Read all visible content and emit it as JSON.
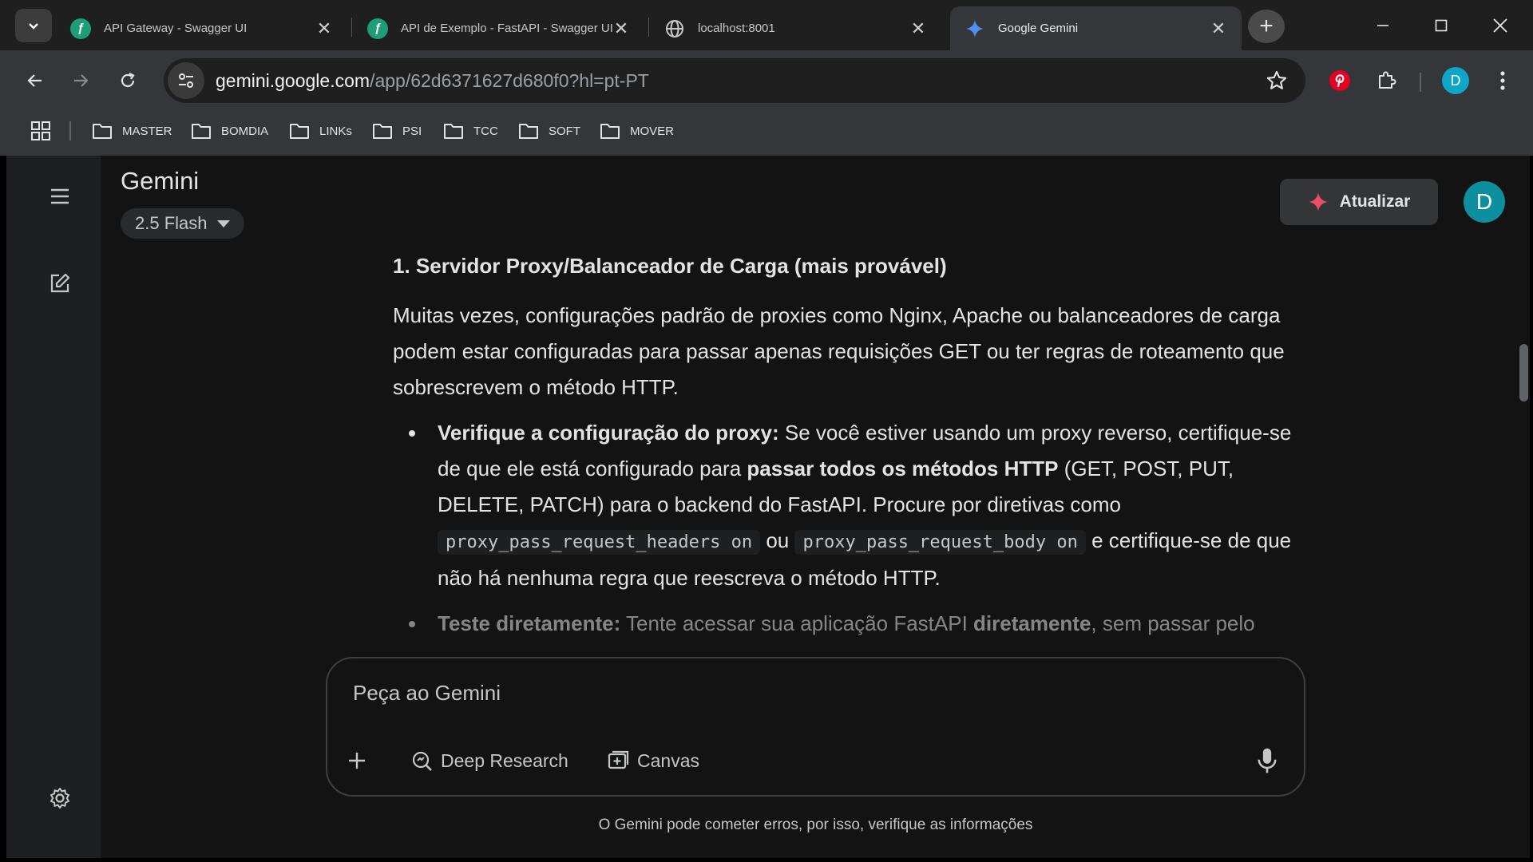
{
  "browser": {
    "tabs": [
      {
        "title": "API Gateway - Swagger UI",
        "favicon": "swagger-icon",
        "active": false
      },
      {
        "title": "API de Exemplo - FastAPI - Swagger UI",
        "favicon": "swagger-icon",
        "active": false
      },
      {
        "title": "localhost:8001",
        "favicon": "globe-icon",
        "active": false
      },
      {
        "title": "Google Gemini",
        "favicon": "gemini-icon",
        "active": true
      }
    ],
    "url_host": "gemini.google.com",
    "url_path": "/app/62d6371627d680f0?hl=pt-PT",
    "profile_initial": "D",
    "bookmarks": [
      "MASTER",
      "BOMDIA",
      "LINKs",
      "PSI",
      "TCC",
      "SOFT",
      "MOVER"
    ]
  },
  "gemini": {
    "title": "Gemini",
    "model": "2.5 Flash",
    "upgrade_label": "Atualizar",
    "avatar_initial": "D",
    "section_heading": "1. Servidor Proxy/Balanceador de Carga (mais provável)",
    "paragraph": "Muitas vezes, configurações padrão de proxies como Nginx, Apache ou balanceadores de carga podem estar configuradas para passar apenas requisições GET ou ter regras de roteamento que sobrescrevem o método HTTP.",
    "bullets": [
      {
        "bold": "Verifique a configuração do proxy:",
        "t1": " Se você estiver usando um proxy reverso, certifique-se de que ele está configurado para ",
        "bold2": "passar todos os métodos HTTP",
        "t2": " (GET, POST, PUT, DELETE, PATCH) para o backend do FastAPI. Procure por diretivas como ",
        "code1": "proxy_pass_request_headers on",
        "t3": " ou ",
        "code2": "proxy_pass_request_body on",
        "t4": " e certifique-se de que não há nenhuma regra que reescreva o método HTTP."
      },
      {
        "bold": "Teste diretamente:",
        "t1": " Tente acessar sua aplicação FastAPI ",
        "bold2": "diretamente",
        "t2": ", sem passar pelo"
      }
    ],
    "composer_placeholder": "Peça ao Gemini",
    "deep_research_label": "Deep Research",
    "canvas_label": "Canvas",
    "disclaimer": "O Gemini pode cometer erros, por isso, verifique as informações",
    "colors": {
      "accent_star": "#ec4d60",
      "avatar": "#0e8f9e",
      "pinterest": "#e60023"
    }
  }
}
